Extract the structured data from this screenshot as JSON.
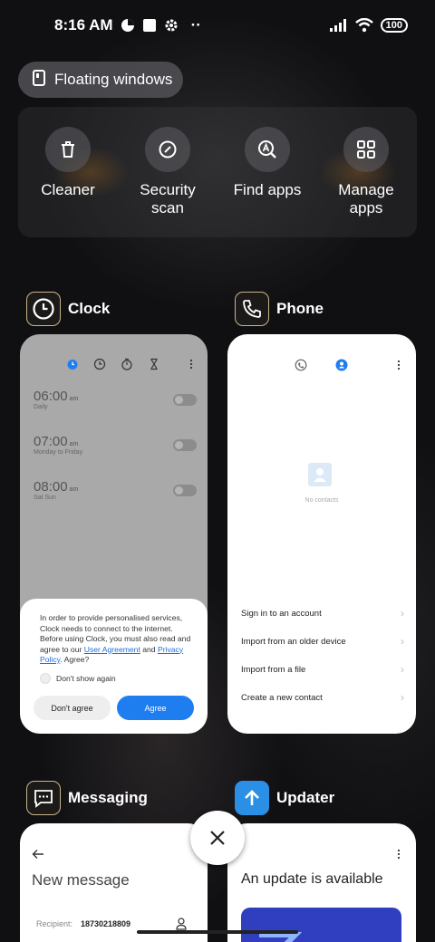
{
  "status_bar": {
    "time": "8:16 AM",
    "battery": "100",
    "overflow": "··"
  },
  "floating_windows": {
    "label": "Floating windows"
  },
  "quick_actions": [
    {
      "label": "Cleaner",
      "icon": "trash-icon"
    },
    {
      "label": "Security scan",
      "icon": "security-scan-icon"
    },
    {
      "label": "Find apps",
      "icon": "find-apps-icon"
    },
    {
      "label": "Manage apps",
      "icon": "manage-apps-icon"
    }
  ],
  "apps": {
    "clock": {
      "name": "Clock",
      "alarms": [
        {
          "time": "06:00",
          "ampm": "am",
          "repeat": "Daily"
        },
        {
          "time": "07:00",
          "ampm": "am",
          "repeat": "Monday to Friday"
        },
        {
          "time": "08:00",
          "ampm": "am",
          "repeat": "Sat Sun"
        }
      ],
      "dialog": {
        "text_before": "In order to provide personalised services, Clock needs to connect to the internet. Before using Clock, you must also read and agree to our ",
        "link1": "User Agreement",
        "and": " and ",
        "link2": "Privacy Policy",
        "text_after": ". Agree?",
        "dont_show": "Don't show again",
        "disagree": "Don't agree",
        "agree": "Agree"
      }
    },
    "phone": {
      "name": "Phone",
      "no_contacts": "No contacts",
      "menu": [
        "Sign in to an account",
        "Import from an older device",
        "Import from a file",
        "Create a new contact"
      ]
    },
    "messaging": {
      "name": "Messaging",
      "title": "New message",
      "recipient_label": "Recipient:",
      "recipient_value": "18730218809"
    },
    "updater": {
      "name": "Updater",
      "title": "An update is available"
    }
  },
  "colors": {
    "accent_blue": "#1e7ef0",
    "updater_icon": "#2b8fe6",
    "updater_banner": "#2f3fbf"
  }
}
